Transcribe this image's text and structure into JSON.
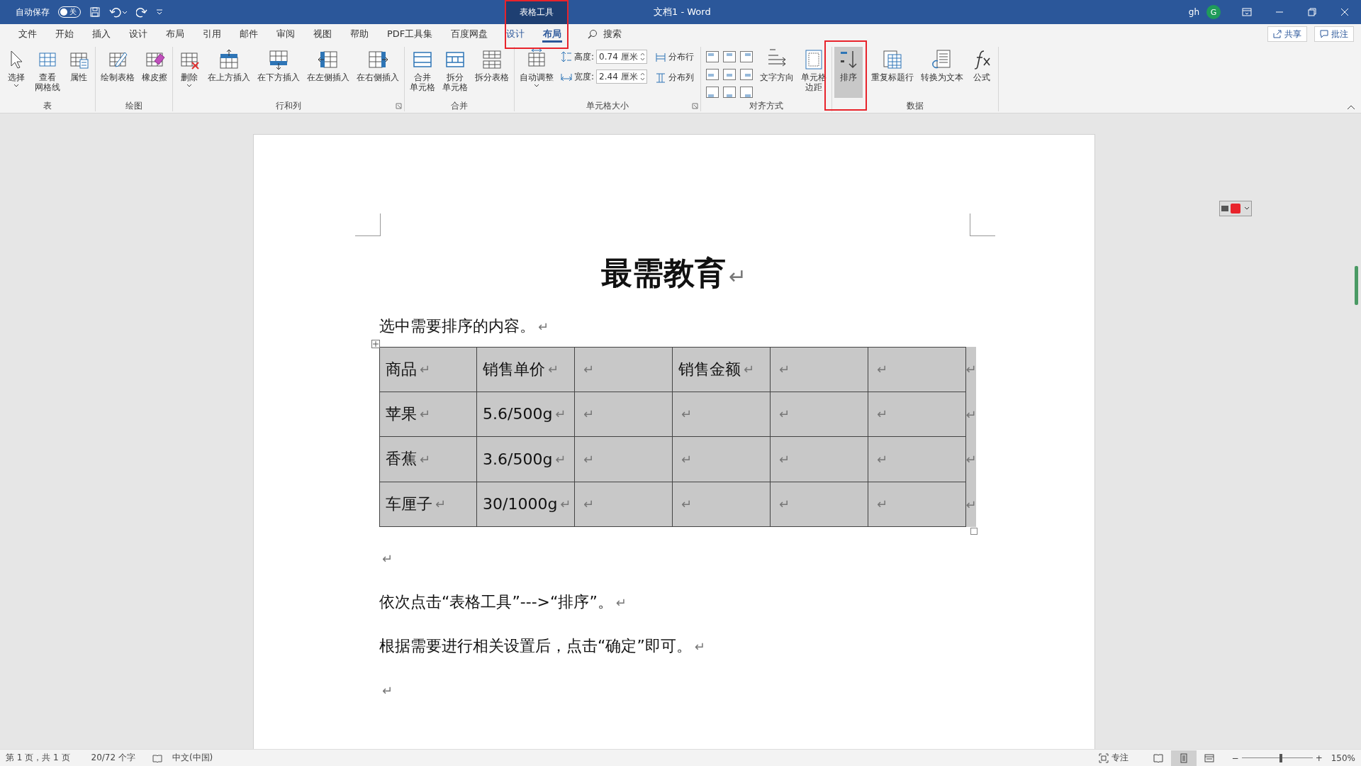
{
  "titlebar": {
    "autosave_label": "自动保存",
    "autosave": {
      "label": "关",
      "on": false
    },
    "context_tab": {
      "label": "表格工具",
      "callout": true
    },
    "title": "文档1 - Word",
    "user": "gh",
    "avatar": "G"
  },
  "tabs": [
    {
      "label": "文件",
      "kind": "main",
      "selected": false
    },
    {
      "label": "开始",
      "kind": "main",
      "selected": false
    },
    {
      "label": "插入",
      "kind": "main",
      "selected": false
    },
    {
      "label": "设计",
      "kind": "main",
      "selected": false
    },
    {
      "label": "布局",
      "kind": "main",
      "selected": false
    },
    {
      "label": "引用",
      "kind": "main",
      "selected": false
    },
    {
      "label": "邮件",
      "kind": "main",
      "selected": false
    },
    {
      "label": "审阅",
      "kind": "main",
      "selected": false
    },
    {
      "label": "视图",
      "kind": "main",
      "selected": false
    },
    {
      "label": "帮助",
      "kind": "main",
      "selected": false
    },
    {
      "label": "PDF工具集",
      "kind": "main",
      "selected": false
    },
    {
      "label": "百度网盘",
      "kind": "main",
      "selected": false
    },
    {
      "label": "设计",
      "kind": "context",
      "selected": false
    },
    {
      "label": "布局",
      "kind": "context",
      "selected": true
    }
  ],
  "search": "搜索",
  "share": "共享",
  "comments": "批注",
  "ribbon": {
    "groups": [
      {
        "label": "表",
        "launcher": false,
        "items": [
          {
            "kind": "large",
            "label": "选择",
            "dropdown": true,
            "selected": false
          },
          {
            "kind": "large",
            "label_lines": [
              "查看",
              "网格线"
            ],
            "dropdown": false,
            "selected": false
          },
          {
            "kind": "large",
            "label": "属性",
            "dropdown": false,
            "selected": false
          }
        ]
      },
      {
        "label": "绘图",
        "launcher": false,
        "items": [
          {
            "kind": "large",
            "label": "绘制表格",
            "dropdown": false,
            "selected": false
          },
          {
            "kind": "large",
            "label": "橡皮擦",
            "dropdown": false,
            "selected": false
          }
        ]
      },
      {
        "label": "行和列",
        "launcher": true,
        "items": [
          {
            "kind": "large",
            "label": "删除",
            "dropdown": true,
            "selected": false
          },
          {
            "kind": "large",
            "label": "在上方插入",
            "dropdown": false,
            "selected": false
          },
          {
            "kind": "large",
            "label": "在下方插入",
            "dropdown": false,
            "selected": false
          },
          {
            "kind": "large",
            "label": "在左侧插入",
            "dropdown": false,
            "selected": false
          },
          {
            "kind": "large",
            "label": "在右侧插入",
            "dropdown": false,
            "selected": false
          }
        ]
      },
      {
        "label": "合并",
        "launcher": false,
        "items": [
          {
            "kind": "large",
            "label_lines": [
              "合并",
              "单元格"
            ],
            "dropdown": false,
            "selected": false
          },
          {
            "kind": "large",
            "label_lines": [
              "拆分",
              "单元格"
            ],
            "dropdown": false,
            "selected": false
          },
          {
            "kind": "large",
            "label": "拆分表格",
            "dropdown": false,
            "selected": false
          }
        ]
      },
      {
        "label": "单元格大小",
        "launcher": true,
        "items": [
          {
            "kind": "large",
            "label": "自动调整",
            "dropdown": true,
            "selected": false
          },
          {
            "kind": "spinners",
            "fields": [
              {
                "label": "高度:",
                "value": "0.74 厘米"
              },
              {
                "label": "宽度:",
                "value": "2.44 厘米"
              }
            ]
          },
          {
            "kind": "smalls",
            "buttons": [
              {
                "label": "分布行"
              },
              {
                "label": "分布列"
              }
            ]
          }
        ]
      },
      {
        "label": "对齐方式",
        "launcher": false,
        "items": [
          {
            "kind": "align-grid",
            "cells": [
              {
                "selected": false
              },
              {
                "selected": false
              },
              {
                "selected": false
              },
              {
                "selected": false
              },
              {
                "selected": false
              },
              {
                "selected": false
              },
              {
                "selected": false
              },
              {
                "selected": false
              },
              {
                "selected": false
              }
            ]
          },
          {
            "kind": "large",
            "label": "文字方向",
            "dropdown": false,
            "selected": false
          },
          {
            "kind": "large",
            "label_lines": [
              "单元格",
              "边距"
            ],
            "dropdown": false,
            "selected": false
          }
        ]
      },
      {
        "label": "数据",
        "launcher": false,
        "items": [
          {
            "kind": "large",
            "label": "排序",
            "dropdown": false,
            "selected": true,
            "callout": true
          },
          {
            "kind": "large",
            "label": "重复标题行",
            "dropdown": false,
            "selected": false
          },
          {
            "kind": "large",
            "label": "转换为文本",
            "dropdown": false,
            "selected": false
          },
          {
            "kind": "large",
            "label": "公式",
            "dropdown": false,
            "selected": false
          }
        ]
      }
    ]
  },
  "document": {
    "blocks": [
      {
        "kind": "title",
        "text": "最需教育",
        "mark": "↵"
      },
      {
        "kind": "text",
        "text": "选中需要排序的内容。",
        "mark": "↵"
      },
      {
        "kind": "table",
        "selected": true,
        "rows": [
          {
            "end_mark": "↵",
            "cells": [
              {
                "text": "商品",
                "mark": "↵"
              },
              {
                "text": "销售单价",
                "mark": "↵"
              },
              {
                "mark": "↵"
              },
              {
                "text": "销售金额",
                "mark": "↵"
              },
              {
                "mark": "↵"
              },
              {
                "mark": "↵"
              }
            ]
          },
          {
            "end_mark": "↵",
            "cells": [
              {
                "text": "苹果",
                "mark": "↵"
              },
              {
                "text": "5.6/500g",
                "mark": "↵"
              },
              {
                "mark": "↵"
              },
              {
                "mark": "↵"
              },
              {
                "mark": "↵"
              },
              {
                "mark": "↵"
              }
            ]
          },
          {
            "end_mark": "↵",
            "cells": [
              {
                "text": "香蕉",
                "mark": "↵"
              },
              {
                "text": "3.6/500g",
                "mark": "↵"
              },
              {
                "mark": "↵"
              },
              {
                "mark": "↵"
              },
              {
                "mark": "↵"
              },
              {
                "mark": "↵"
              }
            ]
          },
          {
            "end_mark": "↵",
            "cells": [
              {
                "text": "车厘子",
                "mark": "↵"
              },
              {
                "text": "30/1000g",
                "mark": "↵"
              },
              {
                "mark": "↵"
              },
              {
                "mark": "↵"
              },
              {
                "mark": "↵"
              },
              {
                "mark": "↵"
              }
            ]
          }
        ]
      },
      {
        "kind": "text",
        "mark": "↵"
      },
      {
        "kind": "text",
        "text": "依次点击“表格工具”--->“排序”。",
        "mark": "↵"
      },
      {
        "kind": "text",
        "text": "根据需要进行相关设置后，点击“确定”即可。",
        "mark": "↵"
      },
      {
        "kind": "text",
        "mark": "↵"
      }
    ]
  },
  "status": {
    "page": "第 1 页，共 1 页",
    "words": "20/72 个字",
    "language": "中文(中国)",
    "focus": "专注",
    "views": [
      {
        "selected": false
      },
      {
        "selected": true
      },
      {
        "selected": false
      }
    ],
    "zoom_out": "−",
    "zoom_in": "+",
    "zoom": {
      "level": 0.55,
      "reading": "150%"
    }
  }
}
